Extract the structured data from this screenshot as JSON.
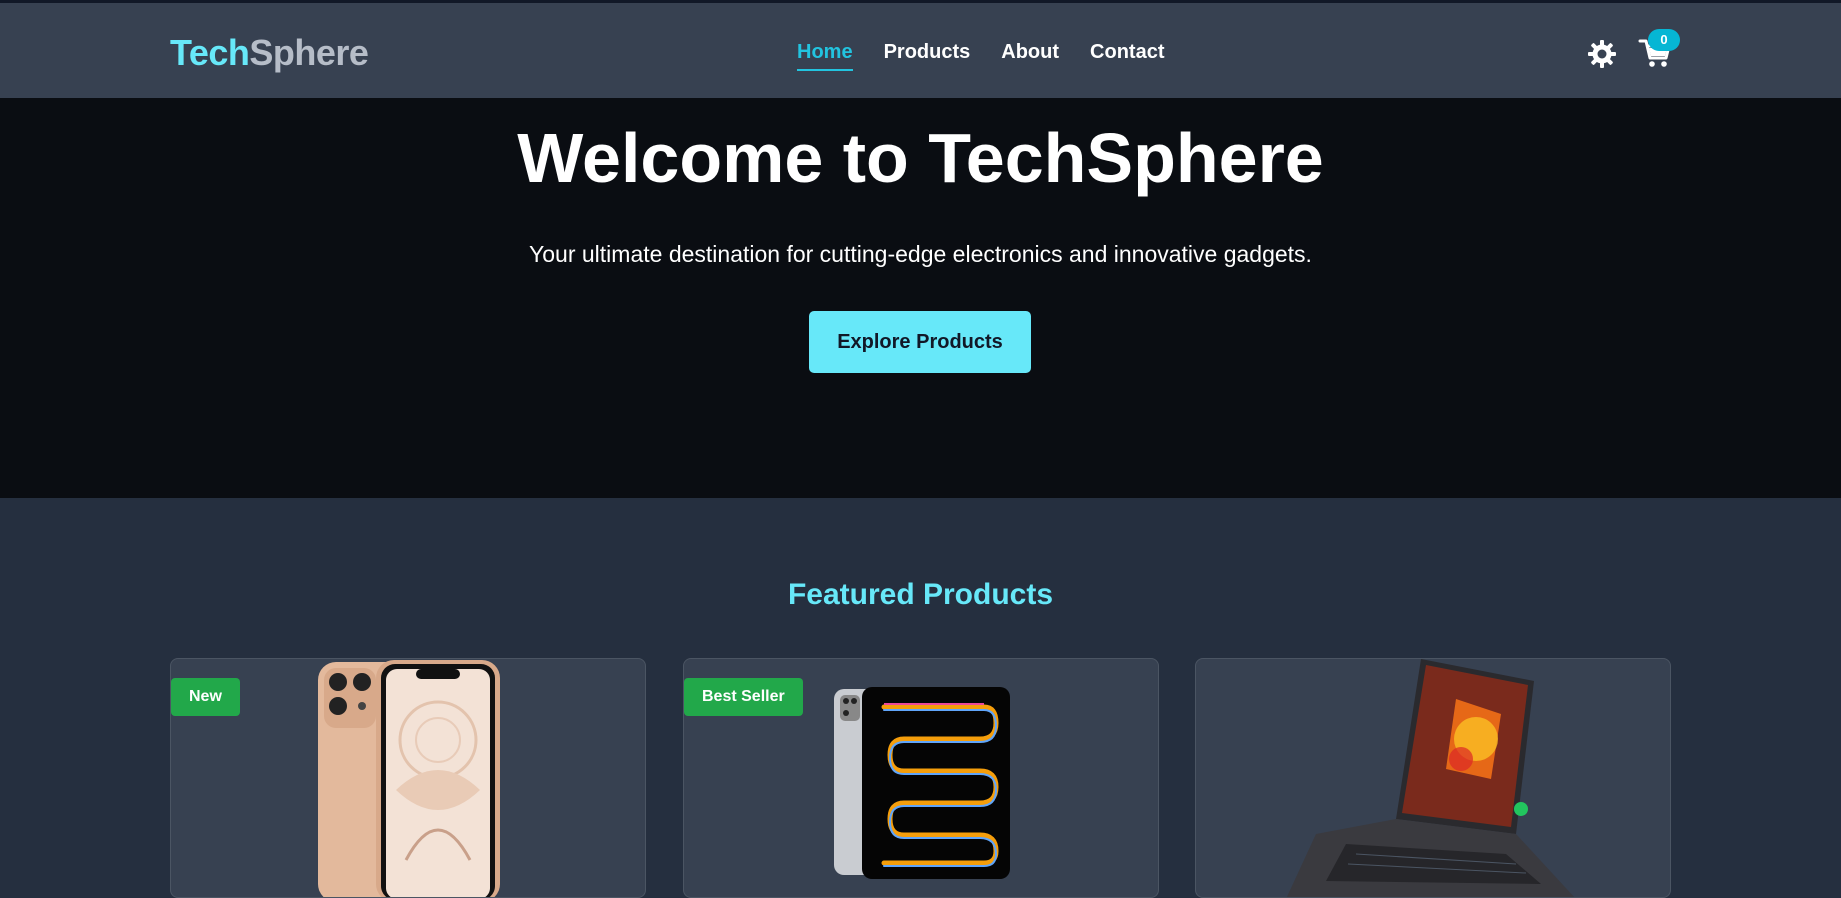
{
  "brand": {
    "part1": "Tech",
    "part2": "Sphere"
  },
  "nav": {
    "items": [
      {
        "label": "Home",
        "active": true
      },
      {
        "label": "Products",
        "active": false
      },
      {
        "label": "About",
        "active": false
      },
      {
        "label": "Contact",
        "active": false
      }
    ]
  },
  "header": {
    "theme_icon": "gear-icon",
    "cart_icon": "cart-icon",
    "cart_count": "0"
  },
  "hero": {
    "title": "Welcome to TechSphere",
    "subtitle": "Your ultimate destination for cutting-edge electronics and innovative gadgets.",
    "cta_label": "Explore Products"
  },
  "featured": {
    "title": "Featured Products",
    "products": [
      {
        "badge": "New",
        "image": "smartphone-image"
      },
      {
        "badge": "Best Seller",
        "image": "tablet-image"
      },
      {
        "badge": "",
        "image": "laptop-image"
      }
    ]
  },
  "colors": {
    "accent": "#67e8f9",
    "nav_active": "#22c4e0",
    "header_bg": "#374151",
    "hero_bg": "#0a0d12",
    "page_bg": "#252f3f",
    "badge_green": "#22a84a"
  }
}
